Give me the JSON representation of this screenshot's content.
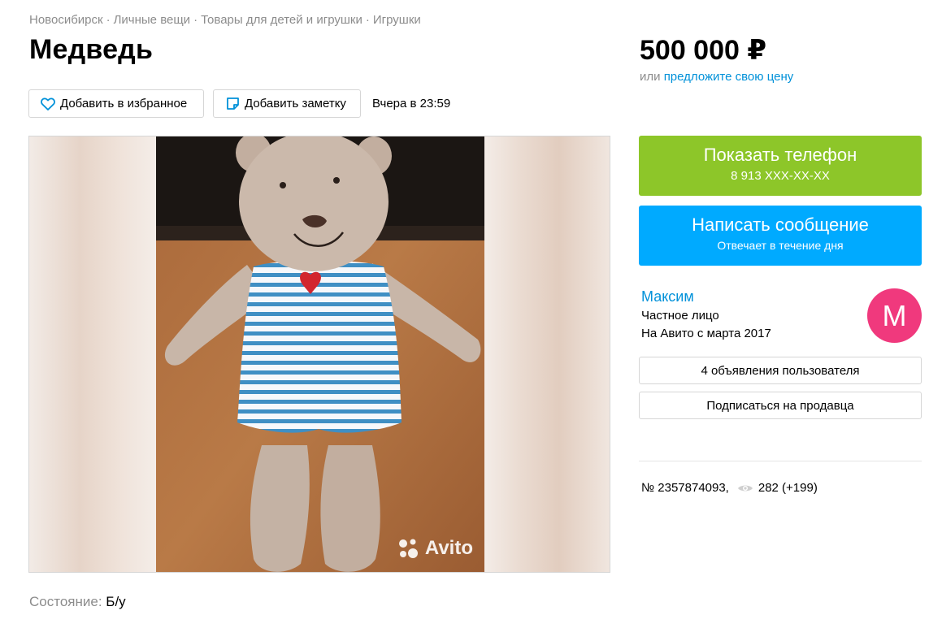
{
  "breadcrumbs": [
    "Новосибирск",
    "Личные вещи",
    "Товары для детей и игрушки",
    "Игрушки"
  ],
  "breadcrumb_separator": "·",
  "title": "Медведь",
  "price": "500 000 ₽",
  "price_offer": {
    "prefix": "или",
    "link": "предложите свою цену"
  },
  "actions": {
    "favorite": "Добавить в избранное",
    "note": "Добавить заметку"
  },
  "posted_date": "Вчера в 23:59",
  "gallery": {
    "watermark": "Avito"
  },
  "contact": {
    "phone_label": "Показать телефон",
    "phone_number": "8 913 XXX-XX-XX",
    "message_label": "Написать сообщение",
    "message_sub": "Отвечает в течение дня"
  },
  "seller": {
    "name": "Максим",
    "type": "Частное лицо",
    "since": "На Авито с марта 2017",
    "avatar_letter": "М",
    "ads_button": "4 объявления пользователя",
    "subscribe_button": "Подписаться на продавца"
  },
  "listing_meta": {
    "number": "№ 2357874093,",
    "views": "282 (+199)"
  },
  "condition": {
    "label": "Состояние:",
    "value": "Б/у"
  },
  "colors": {
    "accent_link": "#0091d9",
    "phone_green": "#8dc629",
    "message_blue": "#00aaff",
    "avatar_pink": "#f0397d"
  },
  "icons": [
    "heart-icon",
    "note-icon",
    "eye-icon",
    "avito-logo-icon"
  ]
}
